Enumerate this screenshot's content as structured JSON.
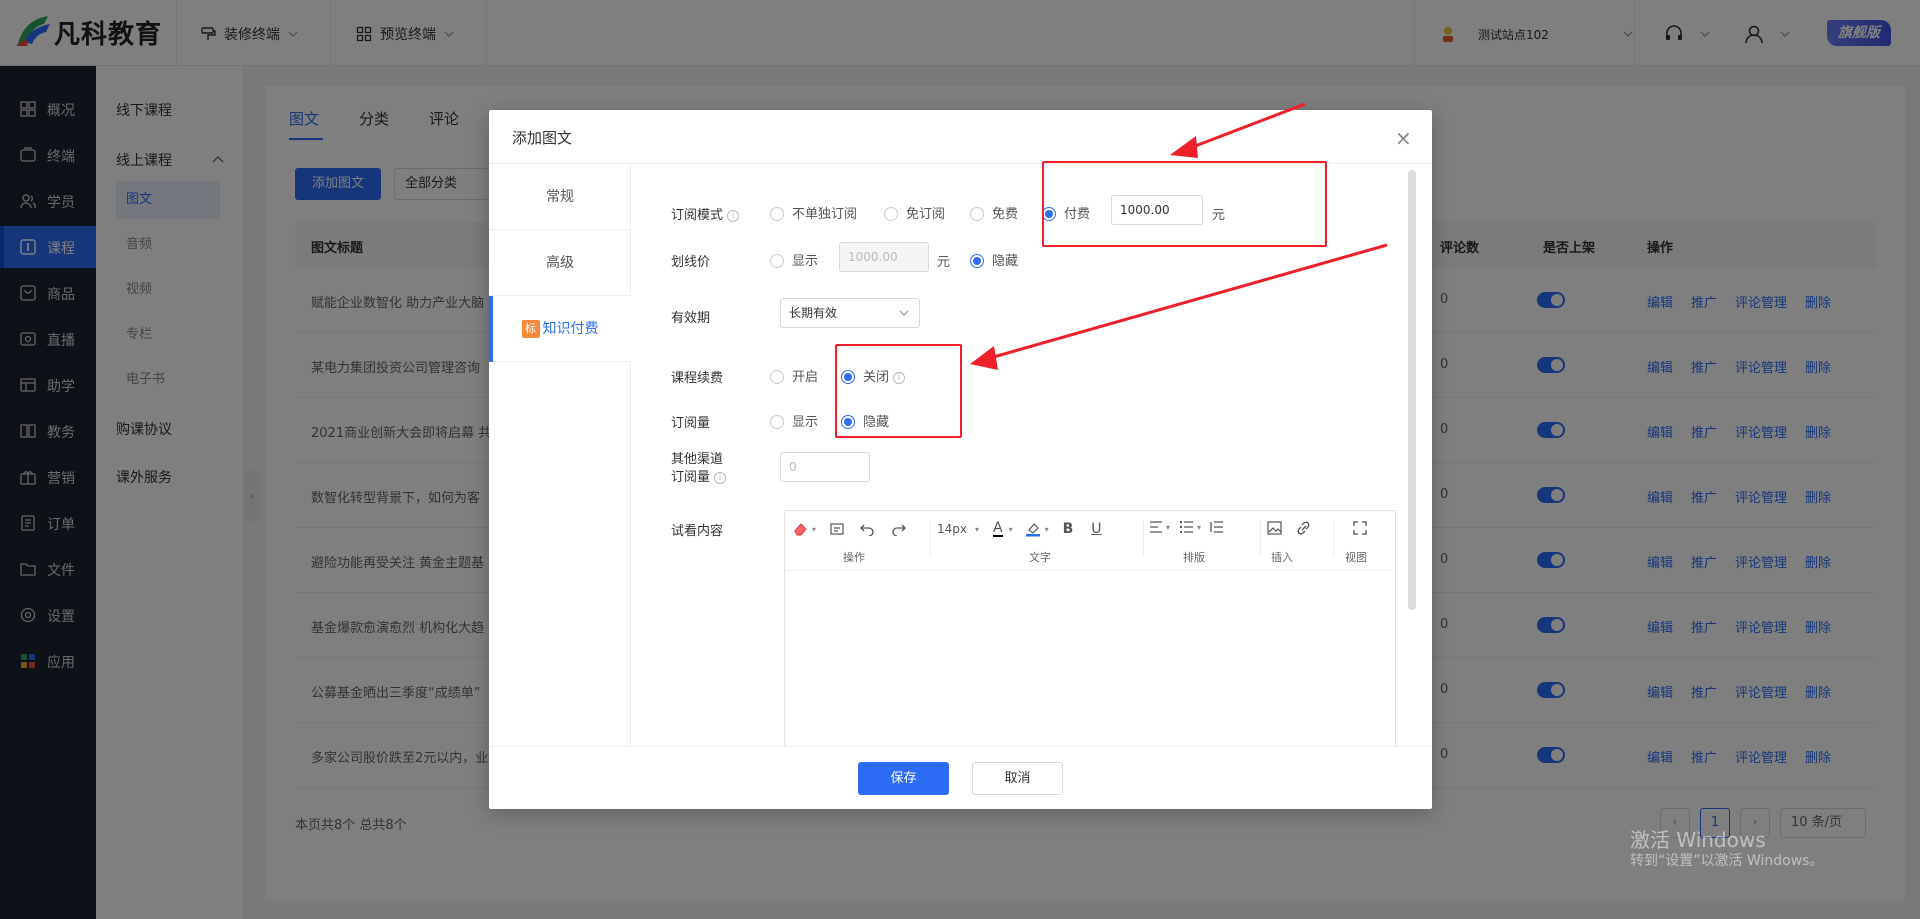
{
  "topbar": {
    "logo_text": "凡科教育",
    "menu1": "装修终端",
    "menu2": "预览终端",
    "site_name": "测试站点102",
    "version_badge": "旗舰版"
  },
  "leftnav": {
    "items": [
      {
        "label": "概况",
        "icon": "dashboard-icon"
      },
      {
        "label": "终端",
        "icon": "terminal-icon"
      },
      {
        "label": "学员",
        "icon": "students-icon"
      },
      {
        "label": "课程",
        "icon": "course-icon"
      },
      {
        "label": "商品",
        "icon": "goods-icon"
      },
      {
        "label": "直播",
        "icon": "live-icon"
      },
      {
        "label": "助学",
        "icon": "assist-icon"
      },
      {
        "label": "教务",
        "icon": "academic-icon"
      },
      {
        "label": "营销",
        "icon": "marketing-icon"
      },
      {
        "label": "订单",
        "icon": "order-icon"
      },
      {
        "label": "文件",
        "icon": "folder-icon"
      },
      {
        "label": "设置",
        "icon": "settings-icon"
      },
      {
        "label": "应用",
        "icon": "apps-icon"
      }
    ]
  },
  "subnav": {
    "offline": "线下课程",
    "online": "线上课程",
    "children": [
      "图文",
      "音频",
      "视频",
      "专栏",
      "电子书"
    ],
    "purchase": "购课协议",
    "extra": "课外服务"
  },
  "main": {
    "tabs": [
      "图文",
      "分类",
      "评论"
    ],
    "add_button": "添加图文",
    "category_select": "全部分类",
    "columns": {
      "title": "图文标题",
      "comments": "评论数",
      "published": "是否上架",
      "ops": "操作"
    },
    "rows": [
      {
        "title": "赋能企业数智化 助力产业大脑",
        "comments": "0"
      },
      {
        "title": "某电力集团投资公司管理咨询",
        "comments": "0"
      },
      {
        "title": "2021商业创新大会即将启幕 共",
        "comments": "0"
      },
      {
        "title": "数智化转型背景下，如何为客",
        "comments": "0"
      },
      {
        "title": "避险功能再受关注 黄金主题基",
        "comments": "0"
      },
      {
        "title": "基金爆款愈演愈烈 机构化大趋",
        "comments": "0"
      },
      {
        "title": "公募基金晒出三季度“成绩单”",
        "comments": "0"
      },
      {
        "title": "多家公司股价跌至2元以内，业",
        "comments": "0"
      }
    ],
    "op_labels": [
      "编辑",
      "推广",
      "评论管理",
      "删除"
    ],
    "page_summary": "本页共8个 总共8个",
    "current_page": "1",
    "page_size": "10 条/页"
  },
  "watermark": {
    "line1": "激活 Windows",
    "line2": "转到“设置”以激活 Windows。"
  },
  "modal": {
    "title": "添加图文",
    "side_tabs": [
      "常规",
      "高级",
      "知识付费"
    ],
    "paid_tag": "标",
    "subscribe_mode": {
      "label": "订阅模式",
      "options": [
        "不单独订阅",
        "免订阅",
        "免费",
        "付费"
      ],
      "selected": "付费",
      "price": "1000.00",
      "unit": "元"
    },
    "strike_price": {
      "label": "划线价",
      "show": "显示",
      "value_placeholder": "1000.00",
      "unit": "元",
      "hide": "隐藏",
      "selected": "隐藏"
    },
    "validity": {
      "label": "有效期",
      "value": "长期有效"
    },
    "renewal": {
      "label": "课程续费",
      "open": "开启",
      "close": "关闭",
      "selected": "关闭"
    },
    "subscriptions": {
      "label": "订阅量",
      "show": "显示",
      "hide": "隐藏",
      "selected": "隐藏"
    },
    "other_channel": {
      "label_line1": "其他渠道",
      "label_line2": "订阅量",
      "placeholder": "0"
    },
    "preview": {
      "label": "试看内容",
      "font_size": "14px",
      "groups": [
        "操作",
        "文字",
        "排版",
        "插入",
        "视图"
      ]
    },
    "save": "保存",
    "cancel": "取消"
  },
  "colors": {
    "accent": "#2d6df6",
    "annotation": "#f0202a",
    "nav_bg": "#1f2330"
  }
}
